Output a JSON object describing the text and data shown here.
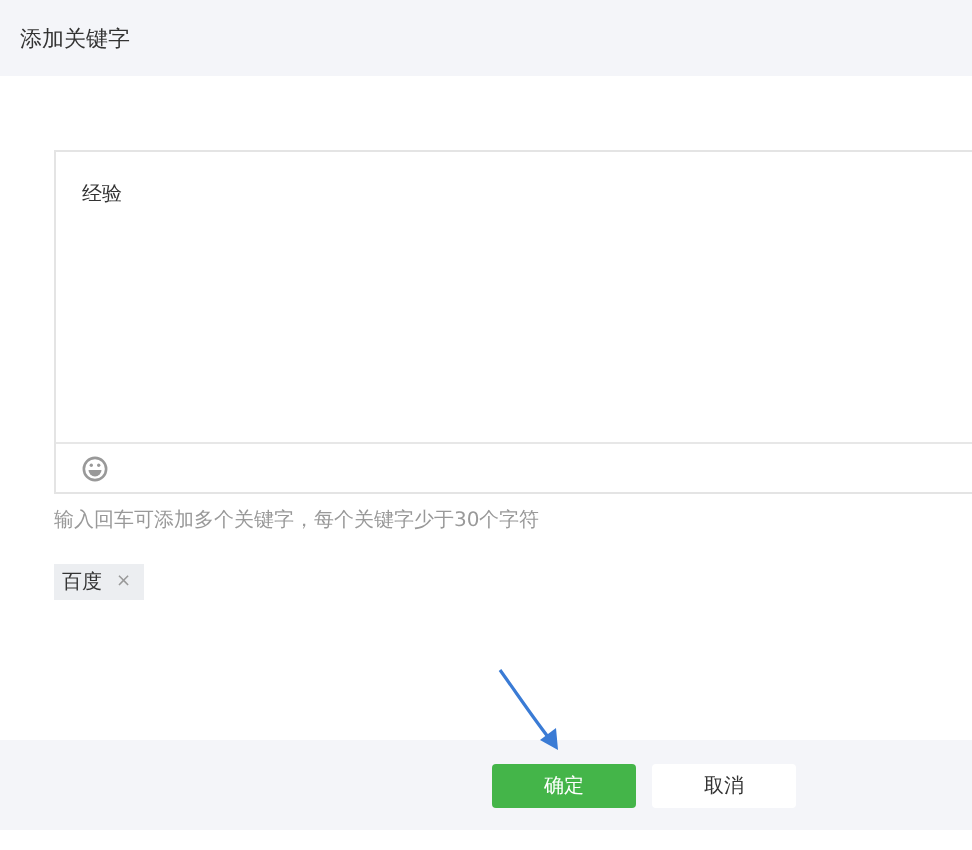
{
  "dialog": {
    "title": "添加关键字"
  },
  "editor": {
    "value": "经验"
  },
  "hint": "输入回车可添加多个关键字，每个关键字少于30个字符",
  "tags": [
    {
      "label": "百度",
      "remove": "×"
    }
  ],
  "buttons": [
    {
      "label": "确定",
      "kind": "primary"
    },
    {
      "label": "取消",
      "kind": "default"
    }
  ]
}
